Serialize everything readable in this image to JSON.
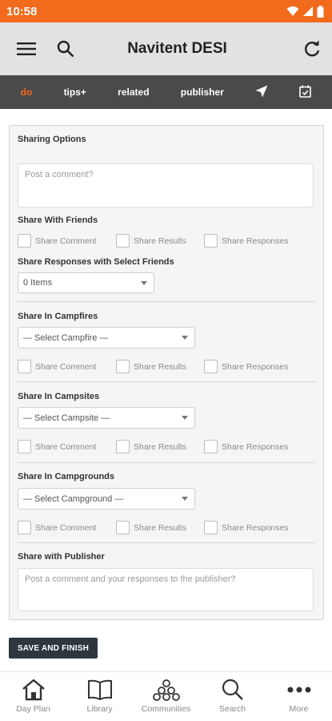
{
  "status": {
    "time": "10:58"
  },
  "app": {
    "title": "Navitent DESI"
  },
  "tabs": [
    {
      "label": "do",
      "active": true
    },
    {
      "label": "tips+"
    },
    {
      "label": "related"
    },
    {
      "label": "publisher"
    }
  ],
  "sharing": {
    "title": "Sharing Options",
    "comment_placeholder": "Post a comment?",
    "friends": {
      "title": "Share With Friends",
      "options": [
        "Share Comment",
        "Share Results",
        "Share Responses"
      ]
    },
    "select_friends": {
      "title": "Share Responses with Select Friends",
      "value": "0 Items"
    },
    "campfires": {
      "title": "Share In Campfires",
      "select": "— Select Campfire —",
      "options": [
        "Share Comment",
        "Share Results",
        "Share Responses"
      ]
    },
    "campsites": {
      "title": "Share In Campsites",
      "select": "— Select Campsite —",
      "options": [
        "Share Comment",
        "Share Results",
        "Share Responses"
      ]
    },
    "campgrounds": {
      "title": "Share In Campgrounds",
      "select": "— Select Campground —",
      "options": [
        "Share Comment",
        "Share Results",
        "Share Responses"
      ]
    },
    "publisher": {
      "title": "Share with Publisher",
      "placeholder": "Post a comment and your responses to the publisher?"
    }
  },
  "save_label": "SAVE AND FINISH",
  "nav": [
    {
      "label": "Day Plan",
      "icon": "home-icon"
    },
    {
      "label": "Library",
      "icon": "book-icon"
    },
    {
      "label": "Communities",
      "icon": "communities-icon"
    },
    {
      "label": "Search",
      "icon": "search-icon"
    },
    {
      "label": "More",
      "icon": "more-icon"
    }
  ],
  "colors": {
    "accent": "#f26a1b",
    "tab_bar": "#4a4a4a",
    "app_bar": "#e2e2e2",
    "button": "#2e3640"
  }
}
